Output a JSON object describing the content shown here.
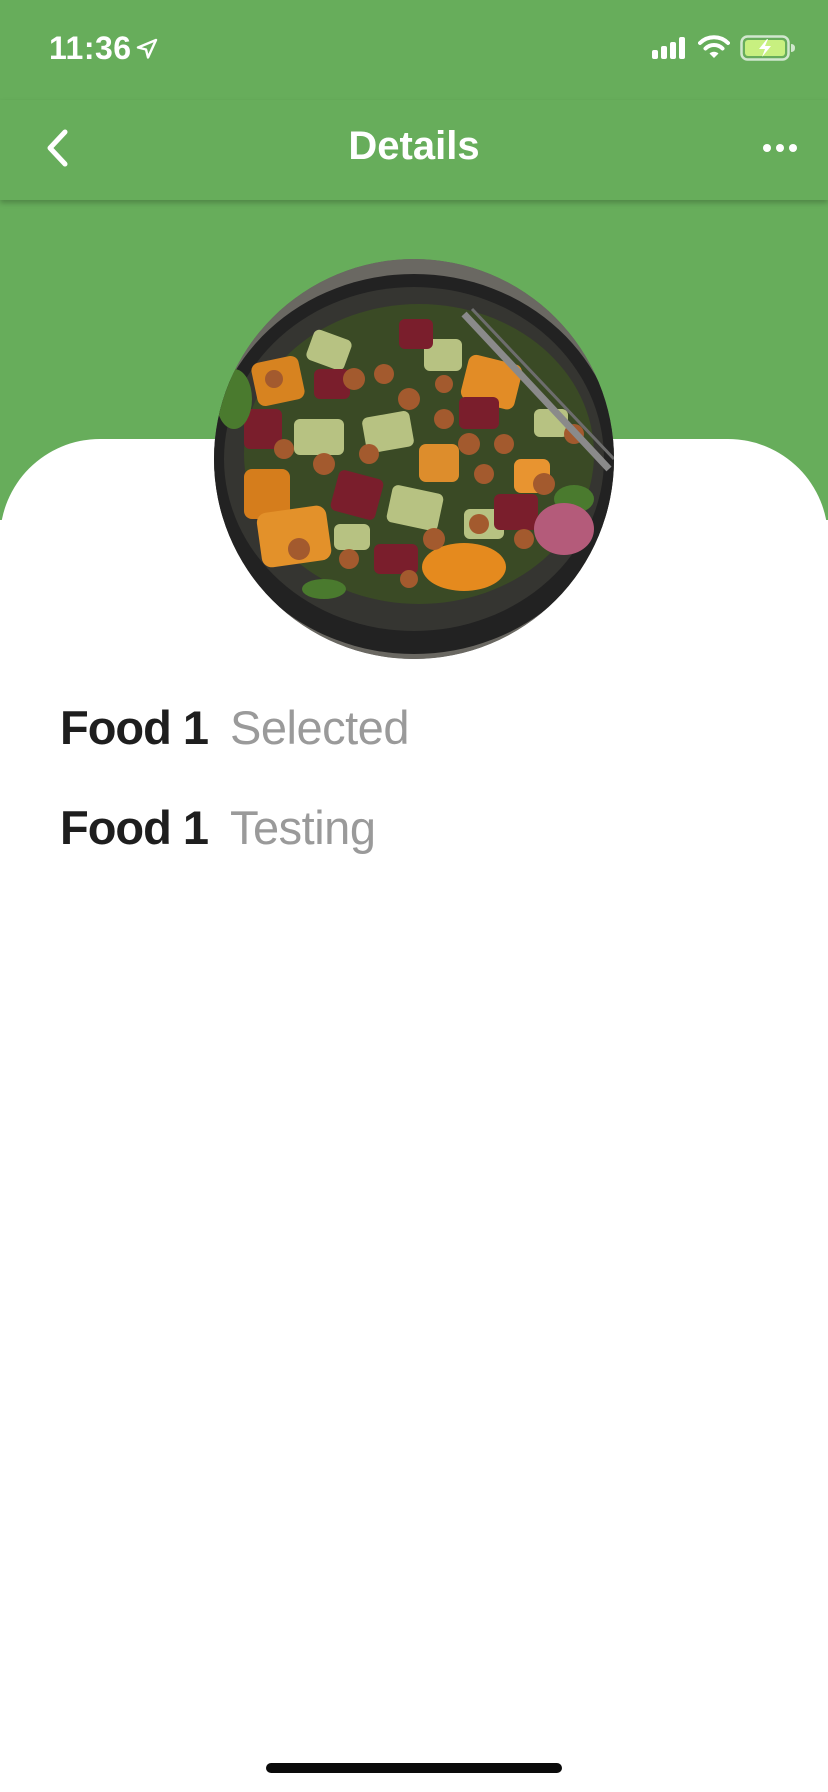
{
  "status_bar": {
    "time": "11:36",
    "icons": [
      "location-arrow-icon",
      "signal-icon",
      "wifi-icon",
      "battery-charging-icon"
    ]
  },
  "nav": {
    "title": "Details",
    "back_icon": "chevron-left-icon",
    "more_icon": "ellipsis-icon"
  },
  "colors": {
    "header_green": "#67ad5b",
    "card_background": "#ffffff",
    "name_text": "#1e1e1e",
    "value_text": "#9a9a9a"
  },
  "details": [
    {
      "name": "Food 1",
      "value": "Selected"
    },
    {
      "name": "Food 1",
      "value": "Testing"
    }
  ]
}
